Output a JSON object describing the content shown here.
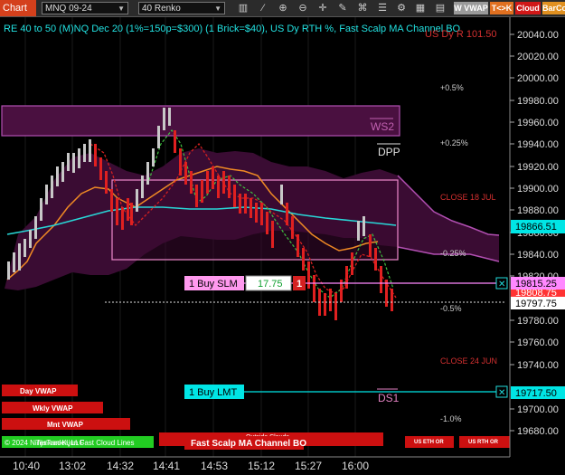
{
  "toolbar": {
    "title": "Chart",
    "instrument": "MNQ 09-24",
    "bar_type": "40 Renko",
    "buttons": [
      {
        "label": "W VWAP",
        "color": "#9a9a9a"
      },
      {
        "label": "T<>K",
        "color": "#e07020"
      },
      {
        "label": "Cloud",
        "color": "#d01818"
      },
      {
        "label": "BarCo",
        "color": "#e09020"
      }
    ]
  },
  "chart": {
    "header_text": "RE 40 to 50 (M)NQ Dec 20 (1%=150p=$300) (1 Brick=$40), US Dy RTH %, Fast Scalp MA Channel BO",
    "header_partial_value": "US Dy R 101.50",
    "price_labels": [
      "20040.00",
      "20020.00",
      "20000.00",
      "19980.00",
      "19960.00",
      "19940.00",
      "19920.00",
      "19900.00",
      "19880.00",
      "19860.00",
      "19840.00",
      "19820.00",
      "19780.00",
      "19760.00",
      "19740.00",
      "19700.00",
      "19680.00"
    ],
    "current_price_tags": [
      {
        "value": "19866.51",
        "color": "#00e5e5"
      },
      {
        "value": "19815.25",
        "color": "#ff88ff"
      },
      {
        "value": "19808.75",
        "color": "#ff3333"
      },
      {
        "value": "19797.75",
        "color": "#ffffff"
      },
      {
        "value": "19717.50",
        "color": "#00e5e5"
      }
    ],
    "time_labels": [
      "10:40",
      "13:02",
      "14:32",
      "14:41",
      "14:53",
      "15:12",
      "15:27",
      "16:00"
    ],
    "percent_labels": [
      {
        "text": "+0.5%",
        "color": "#cccccc"
      },
      {
        "text": "+0.25%",
        "color": "#cccccc"
      },
      {
        "text": "CLOSE 18 JUL",
        "color": "#d43030"
      },
      {
        "text": "-0.25%",
        "color": "#cccccc"
      },
      {
        "text": "-0.5%",
        "color": "#cccccc"
      },
      {
        "text": "CLOSE 24 JUN",
        "color": "#d43030"
      },
      {
        "text": "-1.0%",
        "color": "#cccccc"
      }
    ],
    "levels": {
      "ws2": "WS2",
      "dpp": "DPP",
      "ds1": "DS1"
    },
    "orders": {
      "buy_slm_label": "1 Buy SLM",
      "buy_slm_value": "17.75",
      "buy_slm_qty": "1",
      "buy_lmt_label": "1 Buy LMT",
      "close_symbol": "✕"
    },
    "indicators": [
      {
        "label": "Day VWAP",
        "color": "#cc1010"
      },
      {
        "label": "Wkly VWAP",
        "color": "#cc1010"
      },
      {
        "label": "Mnt VWAP",
        "color": "#cc1010"
      },
      {
        "label": "Tenkan-Kijun Fast Cloud Lines",
        "color": "#22cc22"
      },
      {
        "label": "Outside Clouds",
        "color": "#cc1010"
      },
      {
        "label": "Fast Scalp MA Channel BO",
        "color": "#cc1010"
      },
      {
        "label": "US ETH OR",
        "color": "#cc1010"
      },
      {
        "label": "US RTH OR",
        "color": "#cc1010"
      }
    ],
    "copyright": "© 2024 NinjaTrader, LLC"
  }
}
